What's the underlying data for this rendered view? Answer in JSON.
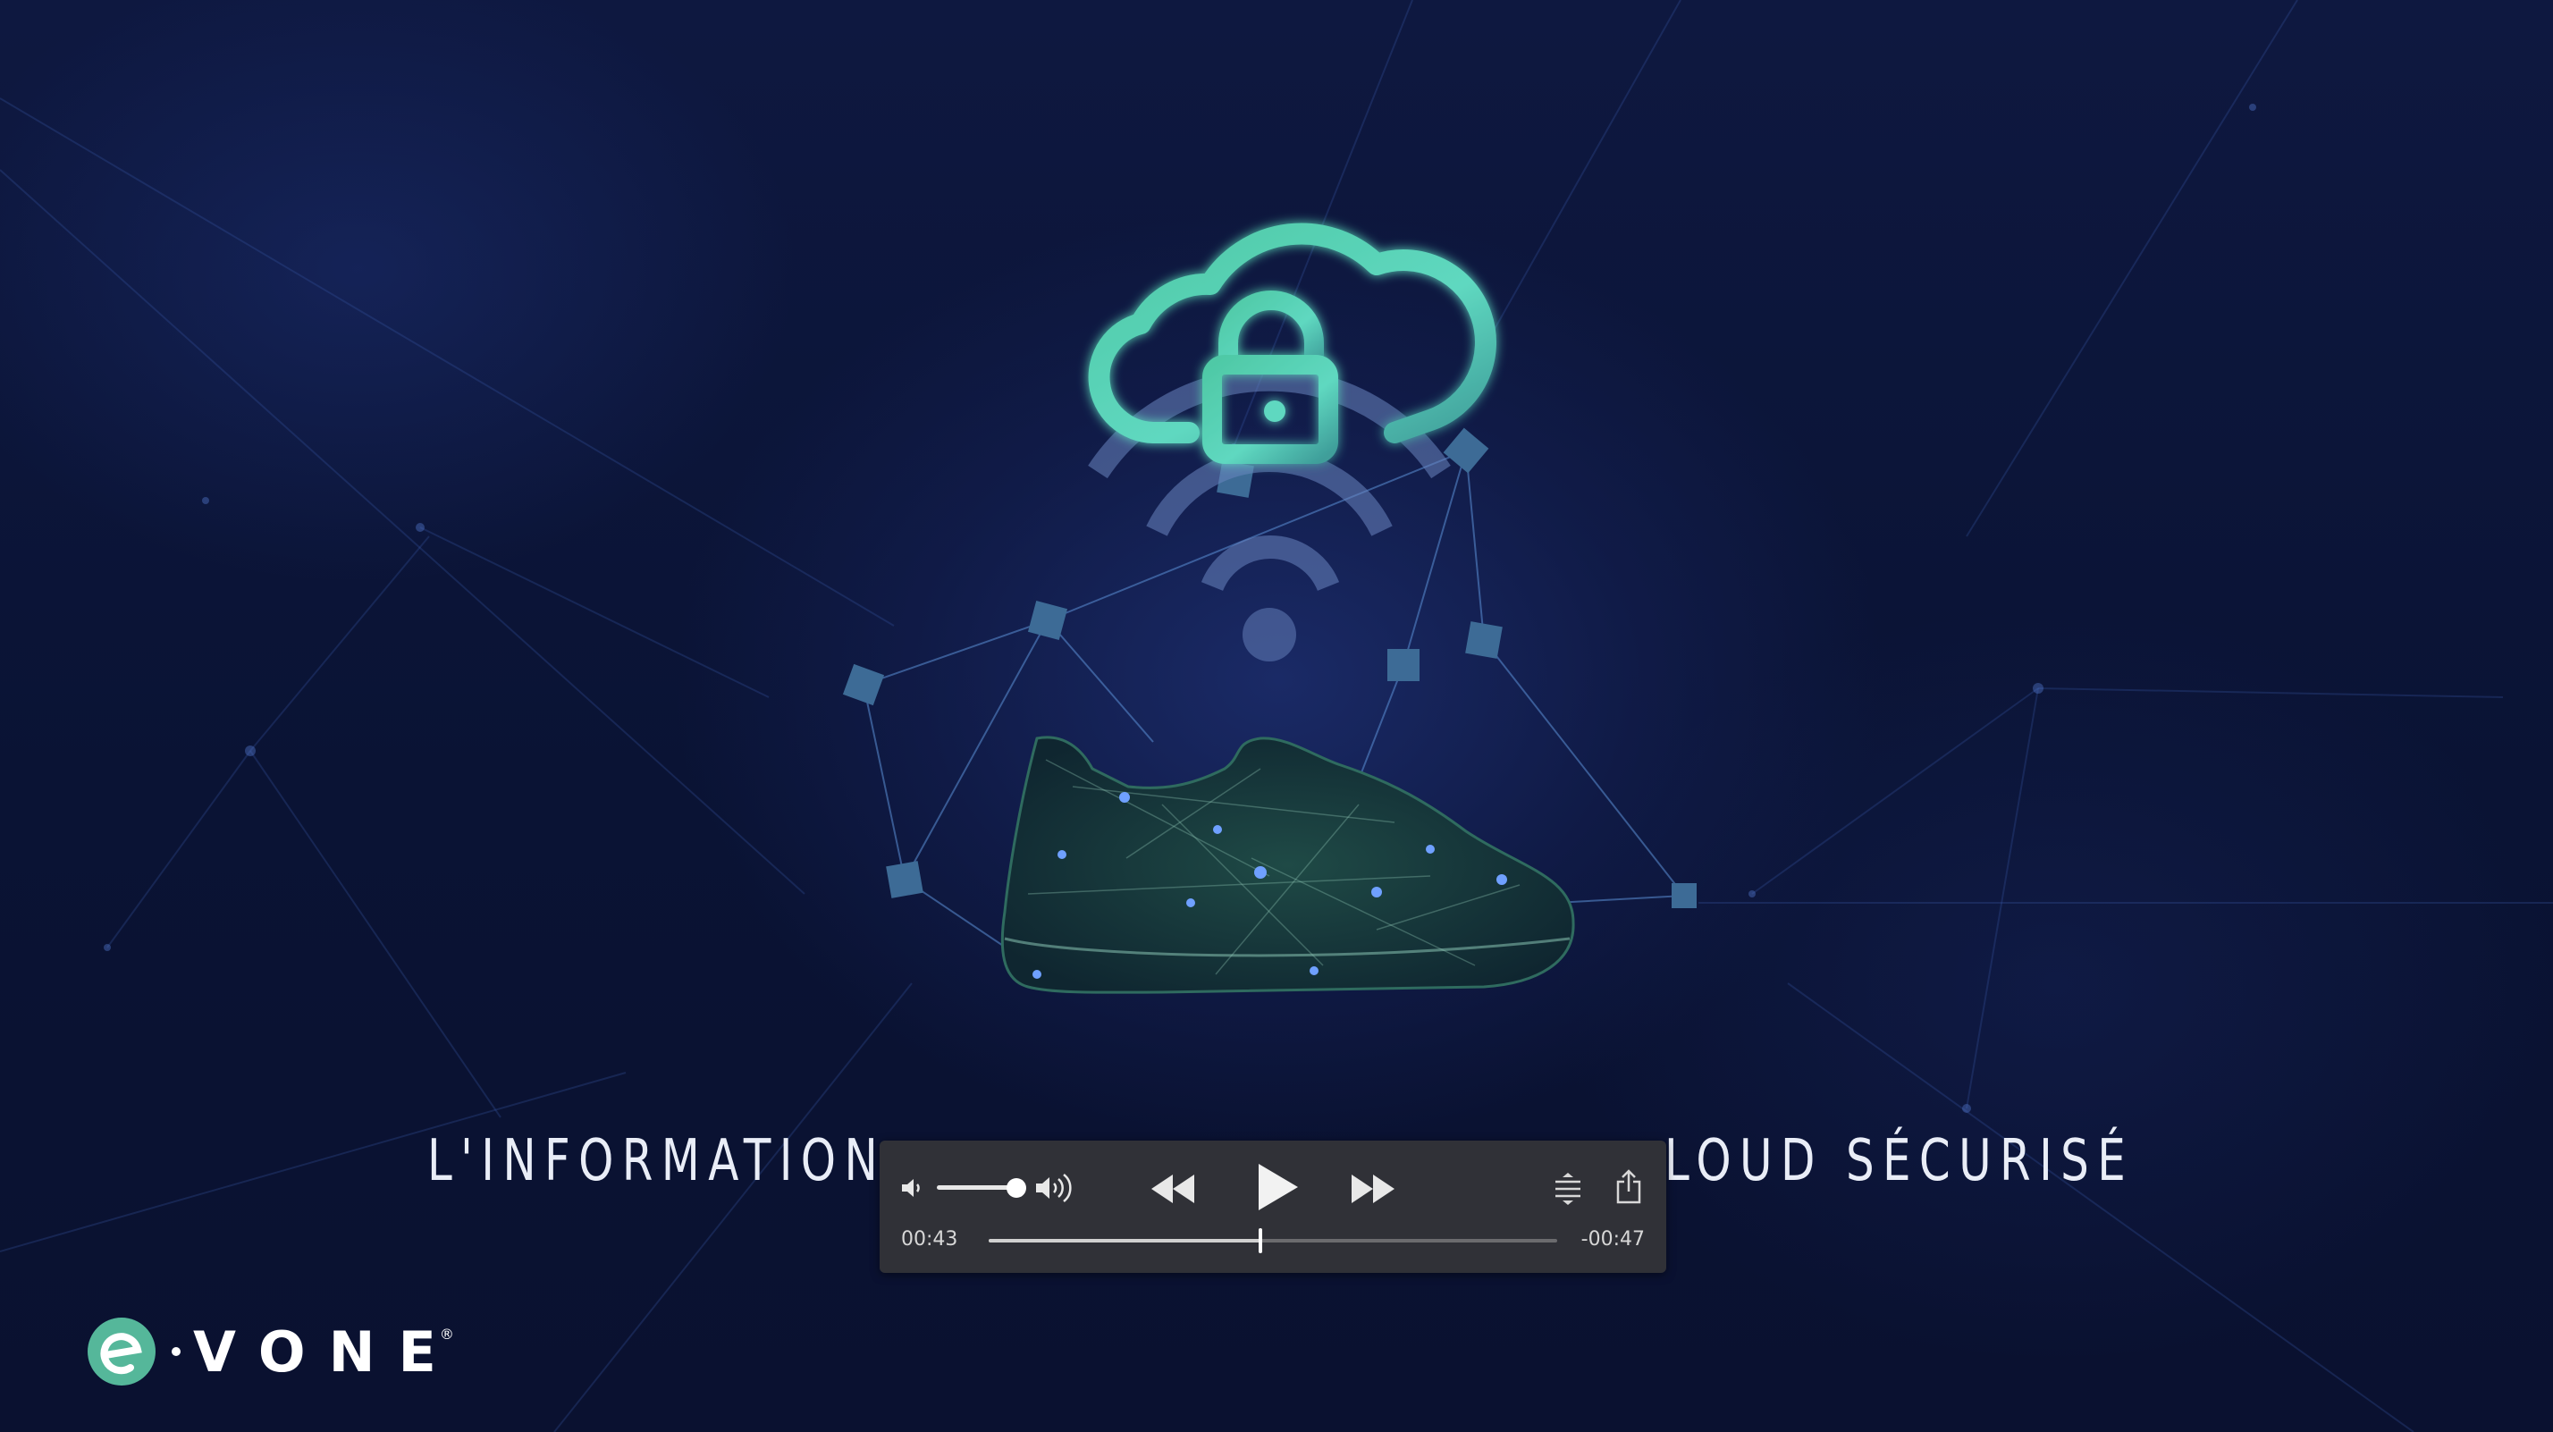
{
  "video": {
    "caption_left": "L'INFORMATION",
    "caption_right": "LOUD SÉCURISÉ",
    "scene_icons": [
      "cloud-lock-icon",
      "wifi-icon",
      "sneaker-illustration"
    ],
    "colors": {
      "background": "#0b1230",
      "accent_teal": "#5fd0b0",
      "node_blue": "#3d6b96"
    }
  },
  "player": {
    "elapsed": "00:43",
    "remaining": "-00:47",
    "progress": 0.478,
    "volume": 0.9,
    "buttons": {
      "volume_low": "speaker-low-icon",
      "volume_high": "speaker-high-icon",
      "rewind": "rewind-icon",
      "play": "play-icon",
      "fast_forward": "fast-forward-icon",
      "playback_speed": "playback-speed-icon",
      "share": "share-icon"
    }
  },
  "logo": {
    "wordmark": "VONE",
    "registered": "®",
    "colors": {
      "mark": "#55b79a",
      "text": "#ffffff"
    }
  }
}
